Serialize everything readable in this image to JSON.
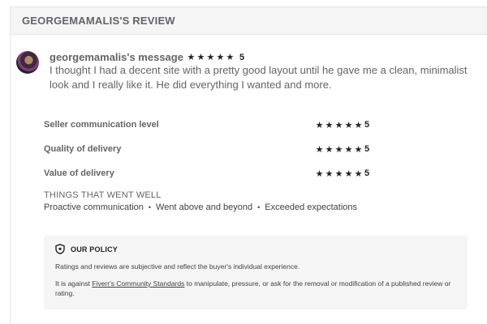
{
  "review": {
    "header_title": "GEORGEMAMALIS'S REVIEW",
    "message": {
      "username": "georgemamalis's message",
      "stars": [
        "★",
        "★",
        "★",
        "★",
        "★"
      ],
      "rating": "5",
      "text": "I thought I had a decent site with a pretty good layout until he gave me a clean, minimalist look and I really like it. He did everything I wanted and more."
    },
    "ratings": [
      {
        "label": "Seller communication level",
        "stars": [
          "★",
          "★",
          "★",
          "★",
          "★"
        ],
        "value": "5"
      },
      {
        "label": "Quality of delivery",
        "stars": [
          "★",
          "★",
          "★",
          "★",
          "★"
        ],
        "value": "5"
      },
      {
        "label": "Value of delivery",
        "stars": [
          "★",
          "★",
          "★",
          "★",
          "★"
        ],
        "value": "5"
      }
    ],
    "went_well": {
      "title": "THINGS THAT WENT WELL",
      "items": [
        "Proactive communication",
        "Went above and beyond",
        "Exceeded expectations"
      ],
      "separator": "•"
    }
  },
  "policy": {
    "title": "OUR POLICY",
    "icon": "shield-icon",
    "text1": "Ratings and reviews are subjective and reflect the buyer's individual experience.",
    "text2_before": "It is against ",
    "link_text": "Fiverr's Community Standards",
    "text2_after": " to manipulate, pressure, or ask for the removal or modification of a published review or rating."
  },
  "colors": {
    "star": "#222325",
    "text_muted": "#62646a",
    "policy_bg": "#f5f5f5",
    "header_bg": "#f5f5f5"
  }
}
